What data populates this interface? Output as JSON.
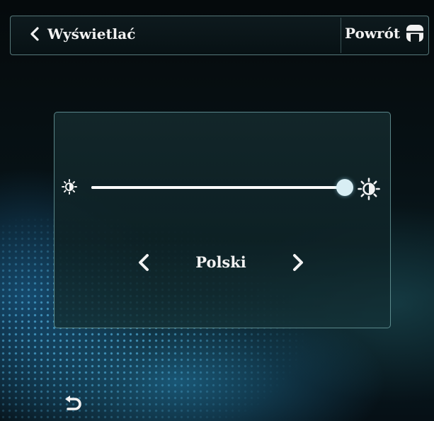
{
  "header": {
    "title": "Wyświetlać",
    "home_label": "Powrót"
  },
  "brightness": {
    "level": 1.0
  },
  "language": {
    "value": "Polski"
  },
  "icons": {
    "back": "chevron-left-icon",
    "home": "home-icon",
    "brightness_low": "brightness-low-icon",
    "brightness_high": "brightness-high-icon",
    "prev": "chevron-left-icon",
    "next": "chevron-right-icon",
    "return": "return-arrow-icon"
  },
  "colors": {
    "text": "#f2f2f2",
    "panel_border": "#8cc8c8",
    "accent": "#5abeeb"
  }
}
